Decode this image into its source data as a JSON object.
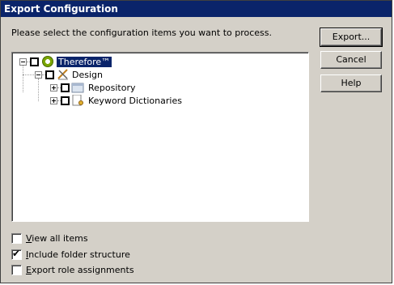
{
  "window": {
    "title": "Export Configuration"
  },
  "prompt": "Please select the configuration items you want to process.",
  "buttons": {
    "export": "Export...",
    "cancel": "Cancel",
    "help": "Help"
  },
  "tree": {
    "root": {
      "label": "Therefore™",
      "checked": false,
      "expanded": true
    },
    "design": {
      "label": "Design",
      "checked": false,
      "expanded": true
    },
    "repository": {
      "label": "Repository",
      "checked": false,
      "expanded": false
    },
    "keyword_dictionaries": {
      "label": "Keyword Dictionaries",
      "checked": false,
      "expanded": false
    }
  },
  "options": {
    "view_all_first": "V",
    "view_all_rest": "iew all items",
    "include_folder_first": "I",
    "include_folder_rest": "nclude folder structure",
    "export_role_first": "E",
    "export_role_rest": "xport role assignments",
    "view_all_checked": false,
    "include_folder_checked": true,
    "export_role_checked": false
  },
  "colors": {
    "title_bar": "#0a246a",
    "dialog_bg": "#d4d0c8",
    "selection": "#0a246a"
  }
}
